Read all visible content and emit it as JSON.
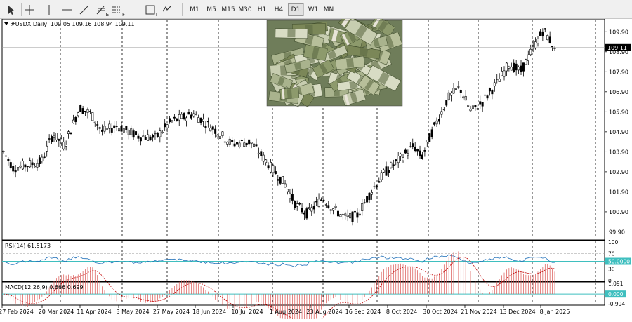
{
  "toolbar": {
    "tools": [
      {
        "name": "cursor-icon",
        "label": ""
      },
      {
        "name": "crosshair-icon",
        "label": ""
      },
      {
        "name": "vertical-line-icon",
        "label": ""
      },
      {
        "name": "horizontal-line-icon",
        "label": ""
      },
      {
        "name": "trendline-icon",
        "label": ""
      },
      {
        "name": "fibonacci-icon",
        "label": "E"
      },
      {
        "name": "channel-icon",
        "label": "F"
      },
      {
        "name": "text-icon",
        "label": "T"
      },
      {
        "name": "shapes-icon",
        "label": ""
      }
    ],
    "timeframes": [
      "M1",
      "M5",
      "M15",
      "M30",
      "H1",
      "H4",
      "D1",
      "W1",
      "MN"
    ],
    "active_timeframe": "D1"
  },
  "chart": {
    "header_symbol": "#USDX,Daily",
    "header_ohlc": "109.05 109.16 108.94 109.11",
    "current_price": "109.11",
    "price_ticks": [
      "109.90",
      "108.90",
      "107.90",
      "106.90",
      "105.90",
      "104.90",
      "103.90",
      "102.90",
      "101.90",
      "100.90",
      "99.90"
    ],
    "date_labels": [
      "27 Feb 2024",
      "20 Mar 2024",
      "11 Apr 2024",
      "3 May 2024",
      "27 May 2024",
      "18 Jun 2024",
      "10 Jul 2024",
      "1 Aug 2024",
      "23 Aug 2024",
      "16 Sep 2024",
      "8 Oct 2024",
      "30 Oct 2024",
      "21 Nov 2024",
      "13 Dec 2024",
      "8 Jan 2025"
    ],
    "image_desc": "stacks of dollar banknotes",
    "colors": {
      "up": "#ffffff",
      "down": "#000000",
      "grid": "#000000",
      "rsi": "#1e6fb8",
      "level": "#3fbfbf",
      "macd_hist": "#d9534f",
      "macd_signal": "#c00000"
    }
  },
  "rsi": {
    "label": "RSI(14) 61.5173",
    "ticks": [
      "100",
      "70",
      "50.0000",
      "30",
      "0"
    ],
    "highlight": "50.0000"
  },
  "macd": {
    "label": "MACD(12,26,9) 0.666 0.699",
    "ticks": [
      "1.091",
      "0.000",
      "-0.994"
    ],
    "highlight": "0.000"
  },
  "chart_data": {
    "type": "candlestick",
    "symbol": "#USDX",
    "timeframe": "Daily",
    "last_ohlc": {
      "open": 109.05,
      "high": 109.16,
      "low": 108.94,
      "close": 109.11
    },
    "ylim": [
      99.6,
      110.4
    ],
    "x": [
      "27 Feb 2024",
      "20 Mar 2024",
      "11 Apr 2024",
      "3 May 2024",
      "27 May 2024",
      "18 Jun 2024",
      "10 Jul 2024",
      "1 Aug 2024",
      "23 Aug 2024",
      "16 Sep 2024",
      "8 Oct 2024",
      "30 Oct 2024",
      "21 Nov 2024",
      "13 Dec 2024",
      "8 Jan 2025"
    ],
    "close_at_labels": [
      103.9,
      103.4,
      106.0,
      105.2,
      104.6,
      105.6,
      104.3,
      103.3,
      100.9,
      100.8,
      102.6,
      103.9,
      107.1,
      107.5,
      109.3
    ],
    "rsi_value": 61.5173,
    "macd": {
      "macd": 0.666,
      "signal": 0.699
    }
  }
}
